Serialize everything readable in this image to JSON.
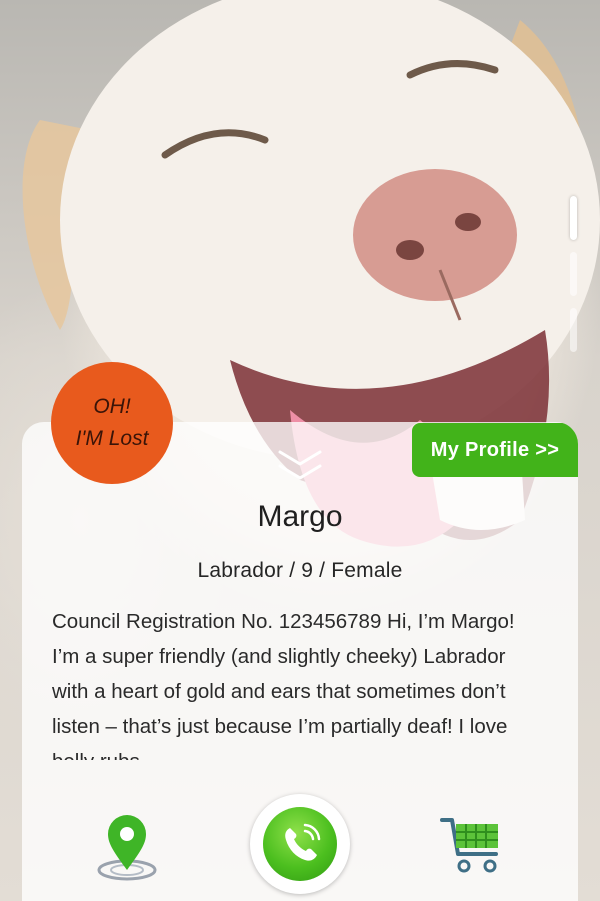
{
  "badge": {
    "line1": "OH!",
    "line2": "I'M Lost"
  },
  "profile_button": {
    "label": "My Profile >>"
  },
  "pet": {
    "name": "Margo",
    "meta": "Labrador / 9 / Female",
    "description": "Council Registration No. 123456789 Hi, I’m Margo! I’m a super friendly (and slightly cheeky) Labrador with a heart of gold and ears that sometimes don’t listen – that’s just because I’m partially deaf! I love belly rubs."
  },
  "pager": {
    "count": 3,
    "active_index": 0
  },
  "actions": [
    {
      "icon": "location-pin-icon"
    },
    {
      "icon": "phone-call-icon"
    },
    {
      "icon": "shopping-cart-icon"
    }
  ],
  "colors": {
    "badge": "#e85a1d",
    "profile_button": "#42b31a",
    "call_button": "#4cbf1f"
  }
}
